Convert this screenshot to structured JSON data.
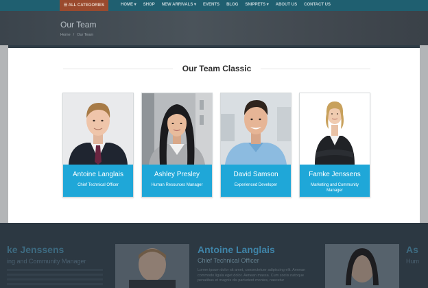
{
  "nav": {
    "all_categories": "☰ ALL CATEGORIES",
    "items": [
      "HOME ▾",
      "SHOP",
      "NEW ARRIVALS ▾",
      "EVENTS",
      "BLOG",
      "SNIPPETS ▾",
      "ABOUT US",
      "CONTACT US"
    ]
  },
  "hero": {
    "title": "Our Team",
    "breadcrumb": {
      "home": "Home",
      "separator": "/",
      "current": "Our Team"
    }
  },
  "section": {
    "title": "Our Team Classic"
  },
  "team": [
    {
      "name": "Antoine Langlais",
      "role": "Chief Technical Officer"
    },
    {
      "name": "Ashley Presley",
      "role": "Human Resources Manager"
    },
    {
      "name": "David Samson",
      "role": "Experienced Developer"
    },
    {
      "name": "Famke Jenssens",
      "role": "Marketing and Community Manager"
    }
  ],
  "background_lower": {
    "left_name": "ke Jenssens",
    "left_role": "ing and Community Manager",
    "center_name": "Antoine Langlais",
    "center_role": "Chief Technical Officer",
    "center_text": "Lorem ipsum dolor sit amet, consectetuer adipiscing elit. Aenean commodo ligula eget dolor. Aenean massa. Cum sociis natoque penatibus et magnis dis parturient montes, nascetur",
    "right_name": "As",
    "right_role": "Hum"
  },
  "colors": {
    "accent": "#1fa7d8",
    "nav_bg": "#1f5f70",
    "all_categories_bg": "#9a4a2e"
  }
}
